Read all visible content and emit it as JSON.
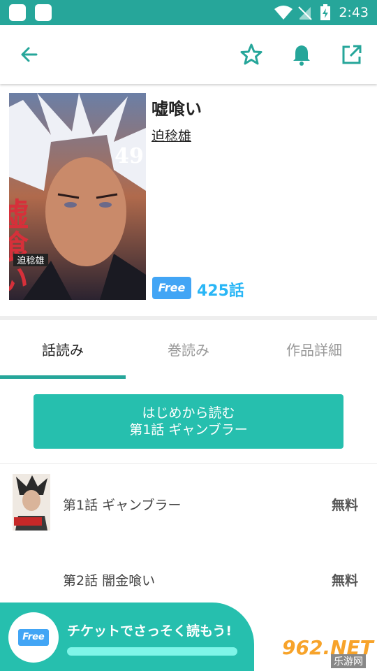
{
  "status_bar": {
    "time": "2:43"
  },
  "series": {
    "title": "嘘喰い",
    "author": "迫稔雄",
    "free_tag": "Free",
    "episode_count": "425話",
    "cover_vol": "49",
    "cover_title": "嘘喰い",
    "cover_author": "迫稔雄"
  },
  "tabs": [
    {
      "label": "話読み"
    },
    {
      "label": "巻読み"
    },
    {
      "label": "作品詳細"
    }
  ],
  "start_button": {
    "line1": "はじめから読む",
    "line2": "第1話 ギャンブラー"
  },
  "episodes": [
    {
      "title": "第1話 ギャンブラー",
      "price": "無料"
    },
    {
      "title": "第2話 闇金喰い",
      "price": "無料"
    }
  ],
  "banner": {
    "free_tag": "Free",
    "text": "チケットでさっそく読もう!"
  },
  "watermark": {
    "text": "962.NET",
    "sub": "乐游网"
  },
  "colors": {
    "accent": "#26a69a",
    "free": "#42a5f5",
    "count": "#29b6f6"
  }
}
